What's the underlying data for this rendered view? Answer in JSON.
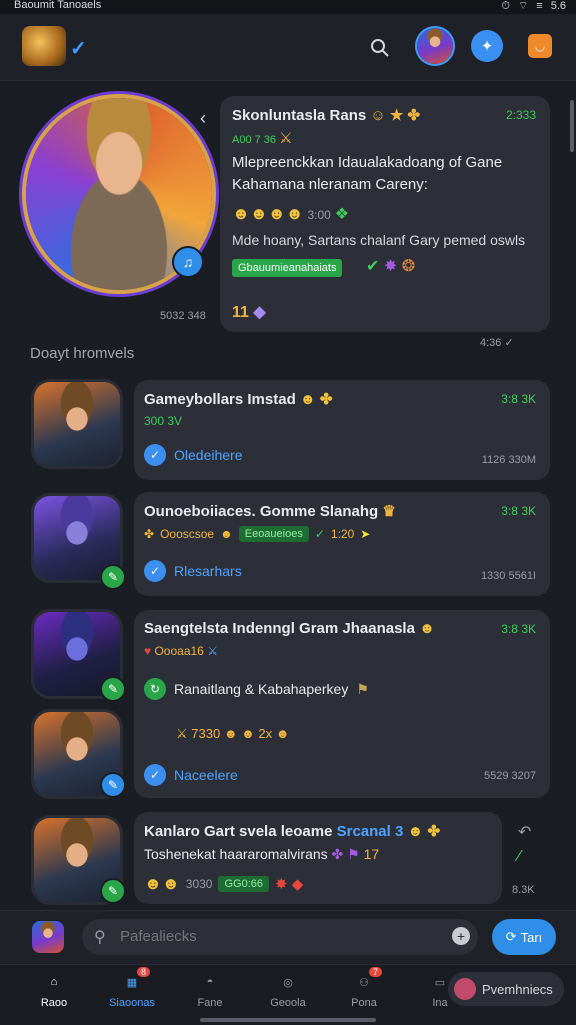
{
  "status_bar": {
    "title": "Baoumit Tanoaels",
    "battery": "5.6"
  },
  "header": {
    "verified_icon": "check-icon"
  },
  "hero_message": {
    "title": "Skonluntasla Rans",
    "time": "2:333",
    "sub": "A00 7 36",
    "line1": "Mlepreenckkan Idaualakadoang of Gane",
    "line2": "Kahamana nleranam Careny:",
    "emoji_time": "3:00",
    "line3": "Mde hoany, Sartans chalanf Gary pemed oswls",
    "tag": "Gbauumieanahaiats",
    "number": "11",
    "hero_time": "5032 348",
    "footer_time": "4:36"
  },
  "section_title": "Doayt hromvels",
  "rows": [
    {
      "name": "Gameybollars Imstad",
      "time": "3:8",
      "time2": "3K",
      "sub": "300 3V",
      "action": "Oledeihere",
      "footer": "1126 330M"
    },
    {
      "name": "Ounoeboiiaces. Gomme Slanahg",
      "time": "3:8",
      "time2": "3K",
      "sub": "Oooscsoe",
      "pill": "Eeoaueioes",
      "pill_after": "1:20",
      "action": "Rlesarhars",
      "footer": "1330 5561I"
    },
    {
      "name": "Saengtelsta Indenngl Gram Jhaanasla",
      "time": "3:8",
      "time2": "3K",
      "sub": "Oooaa16",
      "action2": "Ranaitlang & Kabahaperkey",
      "mid_num": "7330",
      "mid_num2": "2x",
      "action": "Naceelere",
      "footer": "5529 3207"
    },
    {
      "name": "Kanlaro Gart svela leoame",
      "name_hl": "Srcanal 3",
      "sub": "Toshenekat haararomalvirans",
      "sub_num": "17",
      "emoji_num": "3030",
      "pill": "GG0:66",
      "footer": "8.3K"
    }
  ],
  "composer": {
    "placeholder": "Pafealiecks",
    "send": "Tarı"
  },
  "tabs": [
    {
      "label": "Raoo",
      "icon": "home-icon",
      "badge": ""
    },
    {
      "label": "Siaoonas",
      "icon": "store-icon",
      "badge": "8"
    },
    {
      "label": "Fane",
      "icon": "controller-icon",
      "badge": ""
    },
    {
      "label": "Geoola",
      "icon": "compass-icon",
      "badge": ""
    },
    {
      "label": "Pona",
      "icon": "user-icon",
      "badge": "7"
    },
    {
      "label": "Ina",
      "icon": "inbox-icon",
      "badge": ""
    }
  ],
  "toast": {
    "label": "Pvemhniecs"
  },
  "colors": {
    "accent": "#2f8fe8",
    "green": "#3ccf5a",
    "background": "#1b1d24",
    "bubble": "#2c2f38"
  }
}
